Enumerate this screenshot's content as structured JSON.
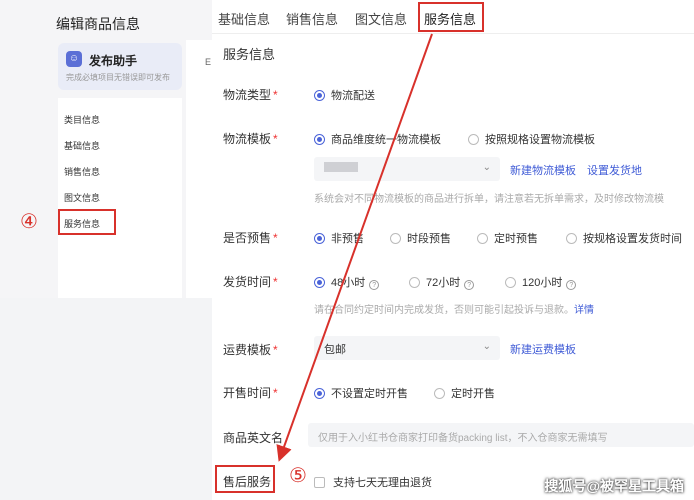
{
  "left": {
    "title": "编辑商品信息",
    "assistant_title": "发布助手",
    "assistant_sub": "完成必填项目无错误即可发布",
    "nav": [
      "类目信息",
      "基础信息",
      "销售信息",
      "图文信息",
      "服务信息"
    ],
    "mid_ghost": "E"
  },
  "tabs": [
    "基础信息",
    "销售信息",
    "图文信息",
    "服务信息"
  ],
  "section_title": "服务信息",
  "form": {
    "logistics_type": {
      "label": "物流类型",
      "options": [
        "物流配送"
      ]
    },
    "logistics_template": {
      "label": "物流模板",
      "options": [
        "商品维度统一物流模板",
        "按照规格设置物流模板"
      ],
      "select_value": "",
      "link_new": "新建物流模板",
      "link_set": "设置发货地",
      "hint": "系统会对不同物流模板的商品进行拆单，请注意若无拆单需求，及时修改物流模"
    },
    "presale": {
      "label": "是否预售",
      "options": [
        "非预售",
        "时段预售",
        "定时预售",
        "按规格设置发货时间"
      ]
    },
    "ship_time": {
      "label": "发货时间",
      "options": [
        "48小时",
        "72小时",
        "120小时"
      ],
      "hint": "请在合同约定时间内完成发货，否则可能引起投诉与退款。",
      "hint_link": "详情"
    },
    "freight": {
      "label": "运费模板",
      "value": "包邮",
      "link": "新建运费模板"
    },
    "sale_time": {
      "label": "开售时间",
      "options": [
        "不设置定时开售",
        "定时开售"
      ]
    },
    "english_name": {
      "label": "商品英文名",
      "placeholder": "仅用于入小红书仓商家打印备货packing list，不入仓商家无需填写"
    },
    "after_sale": {
      "label": "售后服务",
      "checkbox": "支持七天无理由退货"
    }
  },
  "annotations": {
    "step4": "④",
    "step5": "⑤"
  },
  "watermark": "搜狐号@被罕星工具箱",
  "colors": {
    "accent": "#4a63d8",
    "annotation": "#d8312b",
    "link": "#3f5bd6"
  }
}
